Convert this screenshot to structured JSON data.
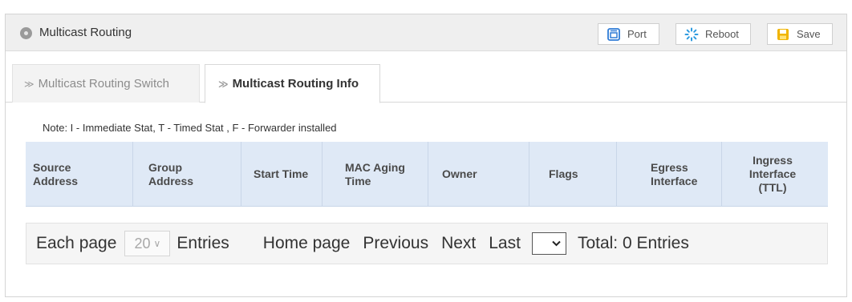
{
  "header": {
    "title": "Multicast Routing",
    "buttons": {
      "port": "Port",
      "reboot": "Reboot",
      "save": "Save"
    }
  },
  "tabs": [
    {
      "label": "Multicast Routing Switch",
      "active": false
    },
    {
      "label": "Multicast Routing Info",
      "active": true
    }
  ],
  "note": "Note:  I - Immediate Stat, T - Timed Stat , F - Forwarder installed",
  "table": {
    "columns": [
      {
        "line1": "Source",
        "line2": "Address",
        "line3": ""
      },
      {
        "line1": "Group",
        "line2": "Address",
        "line3": ""
      },
      {
        "line1": "Start Time",
        "line2": "",
        "line3": ""
      },
      {
        "line1": "MAC Aging",
        "line2": "Time",
        "line3": ""
      },
      {
        "line1": "Owner",
        "line2": "",
        "line3": ""
      },
      {
        "line1": "Flags",
        "line2": "",
        "line3": ""
      },
      {
        "line1": "Egress",
        "line2": "Interface",
        "line3": ""
      },
      {
        "line1": "Ingress",
        "line2": "Interface",
        "line3": "(TTL)"
      }
    ],
    "rows": []
  },
  "pager": {
    "each_page": "Each page",
    "page_size": "20",
    "entries": "Entries",
    "home": "Home page",
    "previous": "Previous",
    "next": "Next",
    "last": "Last",
    "page_value": "",
    "total": "Total: 0 Entries"
  },
  "colors": {
    "header_bg": "#efefef",
    "table_header_bg": "#dfe9f6",
    "port_icon": "#2e7bd6",
    "reboot_icon": "#2e9be0",
    "save_icon": "#f0b400"
  },
  "icons": {
    "title": "gear-dot-icon",
    "port": "port-icon",
    "reboot": "reboot-icon",
    "save": "save-icon",
    "tab": "double-chevron-right-icon",
    "dropdown": "chevron-down-icon"
  }
}
